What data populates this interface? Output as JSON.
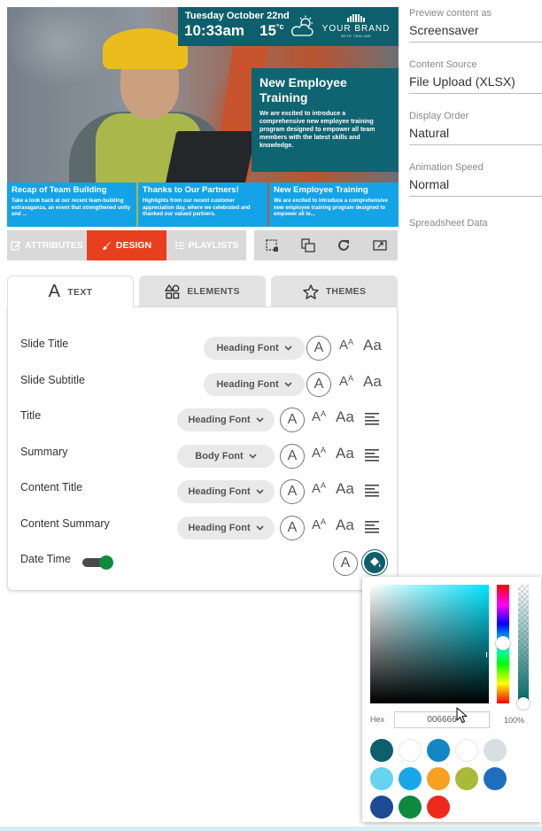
{
  "preview": {
    "date": "Tuesday October 22nd",
    "time": "10:33am",
    "temp": "15",
    "temp_unit": "°c",
    "brand_name": "YOUR BRAND",
    "brand_tagline": "WITH TAGLINE",
    "feature_title": "New Employee Training",
    "feature_text": "We are excited to introduce a comprehensive new employee training program designed to empower all team members with the latest skills and knowledge.",
    "tiles": [
      {
        "title": "Recap of Team Building",
        "text": "Take a look back at our recent team-building extravaganza, an event that strengthened unity and ..."
      },
      {
        "title": "Thanks to Our Partners!",
        "text": "Highlights from our recent customer appreciation day, where we celebrated and thanked our valued partners."
      },
      {
        "title": "New Employee Training",
        "text": "We are excited to introduce a comprehensive new employee training program designed to empower all te..."
      }
    ]
  },
  "mode_bar": {
    "attributes": "ATTRIBUTES",
    "design": "DESIGN",
    "playlists": "PLAYLISTS"
  },
  "tabs": {
    "text": "TEXT",
    "elements": "ELEMENTS",
    "themes": "THEMES"
  },
  "text_rows": [
    {
      "label": "Slide Title",
      "font": "Heading Font"
    },
    {
      "label": "Slide Subtitle",
      "font": "Heading Font"
    },
    {
      "label": "Title",
      "font": "Heading Font"
    },
    {
      "label": "Summary",
      "font": "Body Font"
    },
    {
      "label": "Content Title",
      "font": "Heading Font"
    },
    {
      "label": "Content Summary",
      "font": "Heading Font"
    },
    {
      "label": "Date Time",
      "font": ""
    }
  ],
  "glyphs": {
    "circle_a": "A",
    "size_a_big": "A",
    "size_a_small": "A",
    "case_aa": "Aa"
  },
  "settings": [
    {
      "label": "Preview content as",
      "value": "Screensaver"
    },
    {
      "label": "Content Source",
      "value": "File Upload (XLSX)"
    },
    {
      "label": "Display Order",
      "value": "Natural"
    },
    {
      "label": "Animation Speed",
      "value": "Normal"
    },
    {
      "label": "Spreadsheet Data",
      "value": ""
    }
  ],
  "color_picker": {
    "hex_label": "Hex",
    "hex_value": "006666",
    "alpha": "100%",
    "swatches": [
      "#0e5f6c",
      "#ffffff",
      "#1486c6",
      "#ffffff",
      "#d8dfe3",
      "#66d3f0",
      "#1aa7ea",
      "#f7a021",
      "#a9b93a",
      "#1d6fbd",
      "#1c4a95",
      "#0e8a3e",
      "#ee2a1c"
    ]
  },
  "colors": {
    "accent": "#e8401f",
    "teal": "#0e5f6c",
    "tile_blue": "#14a3e6",
    "toggle_on": "#0e8a3e"
  }
}
